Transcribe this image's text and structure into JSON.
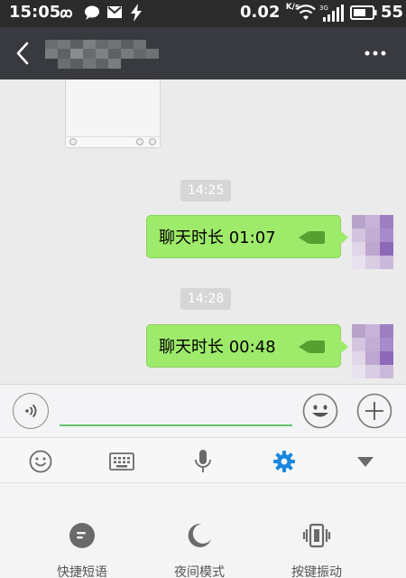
{
  "status_bar": {
    "time": "15:05",
    "speed": "0.02",
    "speed_unit": "K/s",
    "network": "3G",
    "battery": "55"
  },
  "header": {
    "back_icon": "chevron-left-icon",
    "more_icon": "more-horizontal-icon"
  },
  "messages": [
    {
      "timestamp": "14:25",
      "text": "聊天时长 01:07",
      "icon": "video-call-icon"
    },
    {
      "timestamp": "14:28",
      "text": "聊天时长 00:48",
      "icon": "video-call-icon"
    }
  ],
  "input_bar": {
    "value": "",
    "placeholder": ""
  },
  "toolbar": {
    "items": [
      "emoji-icon",
      "keyboard-icon",
      "microphone-icon",
      "settings-icon",
      "collapse-icon"
    ],
    "active": "settings-icon"
  },
  "panel": {
    "items": [
      {
        "label": "快捷短语",
        "icon": "quick-phrase-icon"
      },
      {
        "label": "夜间模式",
        "icon": "night-mode-icon"
      },
      {
        "label": "按键振动",
        "icon": "vibration-icon"
      }
    ]
  },
  "colors": {
    "bubble": "#9eea6a",
    "header": "#393a3f",
    "accent": "#1a88e0",
    "input_underline": "#62c26a"
  }
}
